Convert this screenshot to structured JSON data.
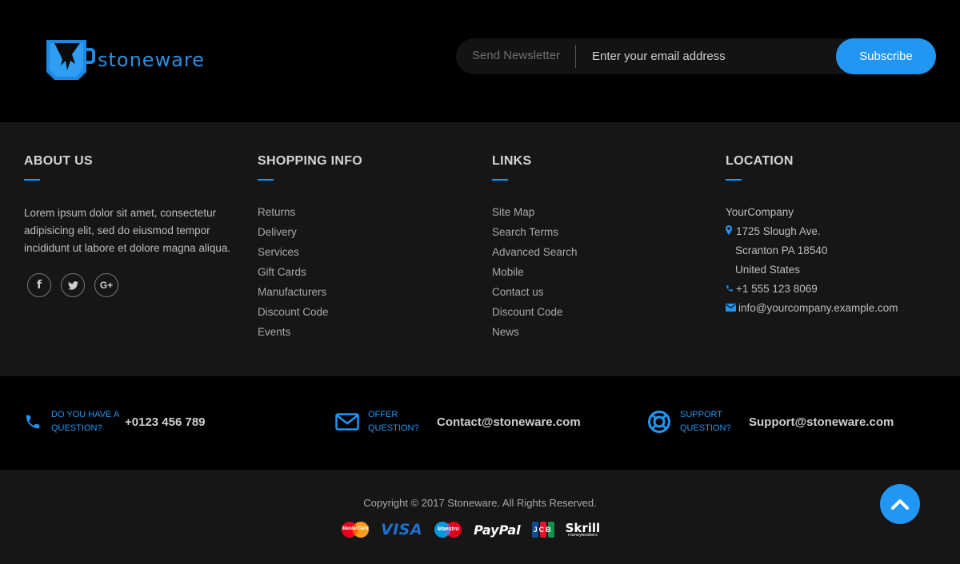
{
  "brand": {
    "name": "stoneware",
    "color": "#2b8fe0"
  },
  "newsletter": {
    "label": "Send Newsletter",
    "placeholder": "Enter your email address",
    "button": "Subscribe"
  },
  "about": {
    "title": "ABOUT US",
    "text": "Lorem ipsum dolor sit amet, consectetur adipisicing elit, sed do eiusmod tempor incididunt ut labore et dolore magna aliqua.",
    "socials": [
      "facebook-icon",
      "twitter-icon",
      "google-plus-icon"
    ],
    "social_glyphs": {
      "facebook": "f",
      "google_plus": "G+"
    }
  },
  "shopping": {
    "title": "SHOPPING INFO",
    "items": [
      "Returns",
      "Delivery",
      "Services",
      "Gift Cards",
      "Manufacturers",
      "Discount Code",
      "Events"
    ]
  },
  "links": {
    "title": "LINKS",
    "items": [
      "Site Map",
      "Search Terms",
      "Advanced Search",
      "Mobile",
      "Contact us",
      "Discount Code",
      "News"
    ]
  },
  "location": {
    "title": "LOCATION",
    "company": "YourCompany",
    "street": "1725 Slough Ave.",
    "city": "Scranton PA 18540",
    "country": "United States",
    "phone": "+1 555 123 8069",
    "email": "info@yourcompany.example.com"
  },
  "contact": {
    "phone": {
      "label_line1": "DO YOU HAVE A",
      "label_line2": "QUESTION?",
      "value": "+0123 456 789"
    },
    "offer": {
      "label_line1": "OFFER",
      "label_line2": "QUESTION?",
      "value": "Contact@stoneware.com"
    },
    "support": {
      "label_line1": "SUPPORT",
      "label_line2": "QUESTION?",
      "value": "Support@stoneware.com"
    }
  },
  "footer": {
    "copyright": "Copyright © 2017 Stoneware. All Rights Reserved.",
    "payments": {
      "mastercard": "MasterCard",
      "visa": "VISA",
      "maestro": "Maestro",
      "paypal": "PayPal",
      "jcb": "JCB",
      "skrill": "Skrill",
      "skrill_sub": "moneybookers"
    }
  },
  "colors": {
    "accent": "#2196f3",
    "background": "#000000",
    "panel": "#161616"
  }
}
